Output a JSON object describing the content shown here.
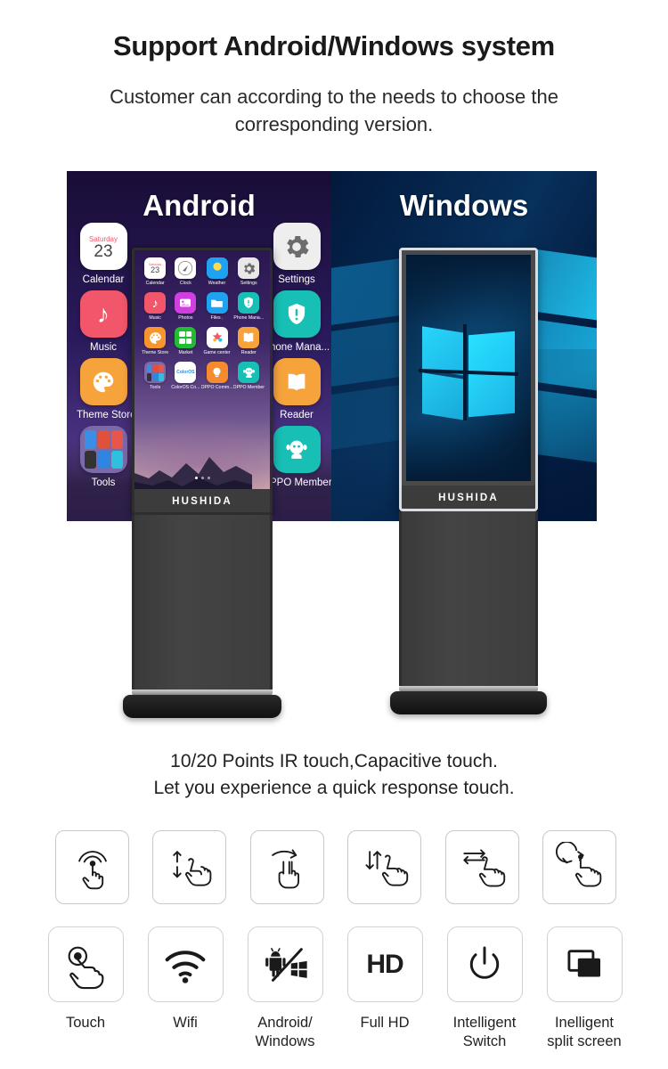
{
  "header": {
    "title": "Support Android/Windows system",
    "subtitle": "Customer can according to the needs to choose the corresponding version."
  },
  "hero": {
    "android_panel": {
      "label": "Android",
      "bg_color": "#1b0f3b",
      "kiosk_brand": "HUSHIDA",
      "background_apps_left": [
        {
          "name": "Calendar",
          "label": "Calendar",
          "icon": "calendar-icon",
          "color": "#ffffff",
          "day": "Saturday",
          "date": "23"
        },
        {
          "name": "Music",
          "label": "Music",
          "icon": "music-note-icon",
          "color": "#f2566a"
        },
        {
          "name": "Theme Store",
          "label": "Theme Store",
          "icon": "palette-icon",
          "color": "#f7a33c"
        },
        {
          "name": "Tools",
          "label": "Tools",
          "icon": "folder-group-icon",
          "color": "#7b6aa8"
        }
      ],
      "background_apps_right": [
        {
          "name": "Settings",
          "label": "Settings",
          "icon": "gear-icon",
          "color": "#eeeeee"
        },
        {
          "name": "Phone Manager",
          "label": "hone Mana...",
          "icon": "shield-alert-icon",
          "color": "#17bfb5"
        },
        {
          "name": "Reader",
          "label": "Reader",
          "icon": "book-icon",
          "color": "#f7a33c"
        },
        {
          "name": "OPPO Member",
          "label": "PPO Member",
          "icon": "mascot-icon",
          "color": "#17bfb5"
        }
      ],
      "kiosk_apps": [
        {
          "label": "Calendar",
          "icon": "calendar-icon",
          "color": "#ffffff",
          "day": "Saturday",
          "date": "23"
        },
        {
          "label": "Clock",
          "icon": "clock-icon",
          "color": "#ffffff"
        },
        {
          "label": "Weather",
          "icon": "weather-sun-icon",
          "color": "#1fa2f0"
        },
        {
          "label": "Settings",
          "icon": "gear-icon",
          "color": "#e8e8e8"
        },
        {
          "label": "Music",
          "icon": "music-note-icon",
          "color": "#f2566a"
        },
        {
          "label": "Photos",
          "icon": "photos-icon",
          "color": "#d13fe0"
        },
        {
          "label": "Files  .",
          "icon": "folder-icon",
          "color": "#1fa2f0"
        },
        {
          "label": "Phone Mana...",
          "icon": "shield-alert-icon",
          "color": "#17bfb5"
        },
        {
          "label": "Theme Store",
          "icon": "palette-icon",
          "color": "#f7952e"
        },
        {
          "label": "Market",
          "icon": "market-grid-icon",
          "color": "#22bb33"
        },
        {
          "label": "Game center",
          "icon": "game-center-icon",
          "color": "#ffffff"
        },
        {
          "label": "Reader",
          "icon": "book-icon",
          "color": "#f7a33c"
        },
        {
          "label": "Tools",
          "icon": "folder-group-icon",
          "color": "#7b6aa8"
        },
        {
          "label": "ColorOS Co...",
          "icon": "coloros-icon",
          "color": "#ffffff"
        },
        {
          "label": "OPPO Comm...",
          "icon": "bulb-icon",
          "color": "#f58a2e"
        },
        {
          "label": "OPPO Member",
          "icon": "mascot-icon",
          "color": "#17bfb5"
        }
      ]
    },
    "windows_panel": {
      "label": "Windows",
      "bg_color": "#021638",
      "kiosk_brand": "HUSHIDA",
      "logo": "windows-logo-icon",
      "logo_color": "#23d3f7"
    }
  },
  "touch_copy": {
    "line1": "10/20 Points IR touch,Capacitive touch.",
    "line2": "Let you experience a quick response touch."
  },
  "gestures": [
    {
      "name": "tap-gesture",
      "icon": "tap-ripple-hand-icon"
    },
    {
      "name": "vertical-drag-gesture",
      "icon": "up-down-arrows-hand-icon"
    },
    {
      "name": "swipe-right-two-finger-gesture",
      "icon": "arrow-right-two-finger-hand-icon"
    },
    {
      "name": "scroll-vertical-gesture",
      "icon": "up-down-arrows-pointer-hand-icon"
    },
    {
      "name": "swipe-horizontal-gesture",
      "icon": "left-right-arrows-hand-icon"
    },
    {
      "name": "rotate-gesture",
      "icon": "rotate-arrow-hand-icon"
    }
  ],
  "features": [
    {
      "name": "touch",
      "label": "Touch",
      "icon": "touch-hand-icon"
    },
    {
      "name": "wifi",
      "label": "Wifi",
      "icon": "wifi-icon"
    },
    {
      "name": "android-windows",
      "label": "Android/\nWindows",
      "label_line1": "Android/",
      "label_line2": "Windows",
      "icon": "android-windows-icon"
    },
    {
      "name": "full-hd",
      "label": "Full HD",
      "icon": "hd-icon",
      "icon_text": "HD"
    },
    {
      "name": "intelligent-switch",
      "label": "Intelligent Switch",
      "label_line1": "Intelligent",
      "label_line2": "Switch",
      "icon": "power-icon"
    },
    {
      "name": "intelligent-split-screen",
      "label": "Inelligent split screen",
      "label_line1": "Inelligent",
      "label_line2": "split screen",
      "icon": "split-screen-icon"
    }
  ]
}
